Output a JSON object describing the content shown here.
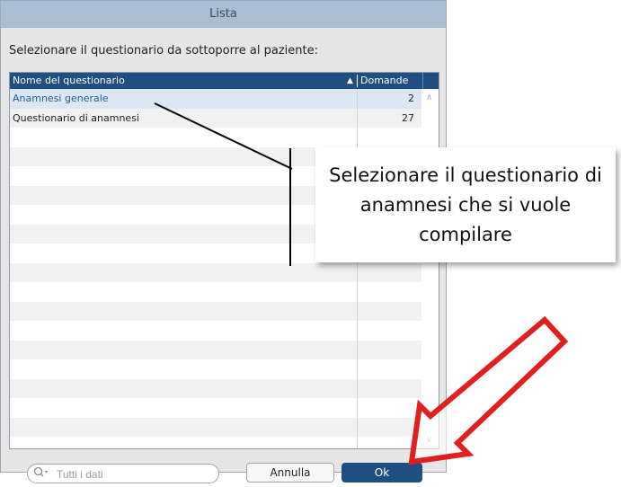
{
  "window": {
    "title": "Lista"
  },
  "prompt": "Selezionare il questionario da sottoporre al paziente:",
  "table": {
    "columns": [
      "Nome del questionario",
      "Domande"
    ],
    "sort_indicator": "▲",
    "rows": [
      {
        "name": "Anamnesi generale",
        "count": "2"
      },
      {
        "name": "Questionario di anamnesi",
        "count": "27"
      }
    ]
  },
  "search": {
    "placeholder": "Tutti i dati"
  },
  "buttons": {
    "cancel": "Annulla",
    "ok": "Ok"
  },
  "callout": {
    "text": "Selezionare il questionario di anamnesi che si vuole compilare"
  },
  "colors": {
    "accent": "#1f4f82",
    "titlebar": "#a9bdd3",
    "annotation_arrow": "#e02020"
  }
}
